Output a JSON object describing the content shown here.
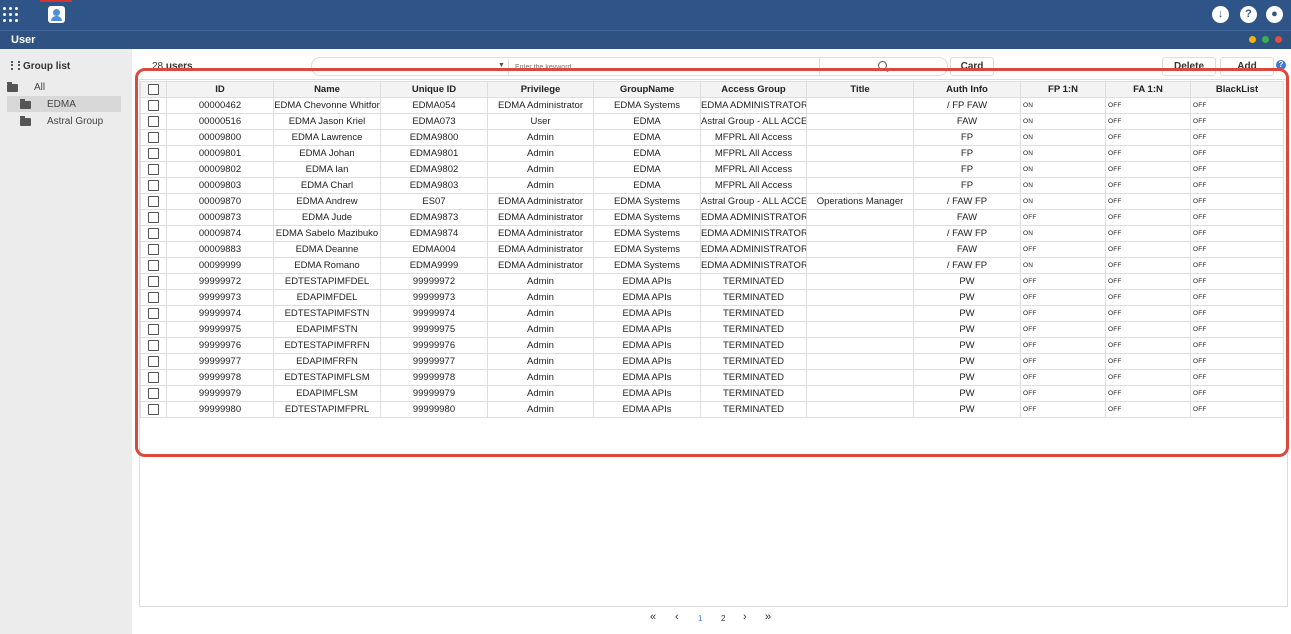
{
  "header": {
    "apps_icon": "grid-apps-icon",
    "user_app_icon": "user-app-icon",
    "right_icons": [
      "download-icon",
      "help-icon",
      "account-icon"
    ]
  },
  "window": {
    "title": "User",
    "buttons": {
      "minimize_color": "#f5b400",
      "maximize_color": "#34b34a",
      "close_color": "#e84c3d"
    }
  },
  "sidebar": {
    "heading": "Group list",
    "items": [
      {
        "label": "All"
      },
      {
        "label": "EDMA"
      },
      {
        "label": "Astral Group"
      }
    ]
  },
  "toolbar": {
    "count_value": "28",
    "count_unit": "users",
    "search_placeholder": "Enter the keyword",
    "card_label": "Card",
    "delete_label": "Delete",
    "add_label": "Add",
    "help_label": "?"
  },
  "table": {
    "headers": [
      "ID",
      "Name",
      "Unique ID",
      "Privilege",
      "GroupName",
      "Access Group",
      "Title",
      "Auth Info",
      "FP 1:N",
      "FA 1:N",
      "BlackList"
    ],
    "rows": [
      [
        "00000462",
        "EDMA Chevonne Whitfor",
        "EDMA054",
        "EDMA Administrator",
        "EDMA Systems",
        "EDMA ADMINISTRATOR",
        "",
        "/ FP FAW",
        "ON",
        "OFF",
        "OFF"
      ],
      [
        "00000516",
        "EDMA Jason Kriel",
        "EDMA073",
        "User",
        "EDMA",
        "Astral Group - ALL ACCES",
        "",
        "FAW",
        "ON",
        "OFF",
        "OFF"
      ],
      [
        "00009800",
        "EDMA Lawrence",
        "EDMA9800",
        "Admin",
        "EDMA",
        "MFPRL All Access",
        "",
        "FP",
        "ON",
        "OFF",
        "OFF"
      ],
      [
        "00009801",
        "EDMA Johan",
        "EDMA9801",
        "Admin",
        "EDMA",
        "MFPRL All Access",
        "",
        "FP",
        "ON",
        "OFF",
        "OFF"
      ],
      [
        "00009802",
        "EDMA Ian",
        "EDMA9802",
        "Admin",
        "EDMA",
        "MFPRL All Access",
        "",
        "FP",
        "ON",
        "OFF",
        "OFF"
      ],
      [
        "00009803",
        "EDMA Charl",
        "EDMA9803",
        "Admin",
        "EDMA",
        "MFPRL All Access",
        "",
        "FP",
        "ON",
        "OFF",
        "OFF"
      ],
      [
        "00009870",
        "EDMA Andrew",
        "ES07",
        "EDMA Administrator",
        "EDMA Systems",
        "Astral Group - ALL ACCES",
        "Operations Manager",
        "/ FAW FP",
        "ON",
        "OFF",
        "OFF"
      ],
      [
        "00009873",
        "EDMA Jude",
        "EDMA9873",
        "EDMA Administrator",
        "EDMA Systems",
        "EDMA ADMINISTRATOR",
        "",
        "FAW",
        "OFF",
        "OFF",
        "OFF"
      ],
      [
        "00009874",
        "EDMA Sabelo Mazibuko",
        "EDMA9874",
        "EDMA Administrator",
        "EDMA Systems",
        "EDMA ADMINISTRATOR",
        "",
        "/ FAW FP",
        "ON",
        "OFF",
        "OFF"
      ],
      [
        "00009883",
        "EDMA Deanne",
        "EDMA004",
        "EDMA Administrator",
        "EDMA Systems",
        "EDMA ADMINISTRATOR",
        "",
        "FAW",
        "OFF",
        "OFF",
        "OFF"
      ],
      [
        "00099999",
        "EDMA Romano",
        "EDMA9999",
        "EDMA Administrator",
        "EDMA Systems",
        "EDMA ADMINISTRATOR",
        "",
        "/ FAW FP",
        "ON",
        "OFF",
        "OFF"
      ],
      [
        "99999972",
        "EDTESTAPIMFDEL",
        "99999972",
        "Admin",
        "EDMA APIs",
        "TERMINATED",
        "",
        "PW",
        "OFF",
        "OFF",
        "OFF"
      ],
      [
        "99999973",
        "EDAPIMFDEL",
        "99999973",
        "Admin",
        "EDMA APIs",
        "TERMINATED",
        "",
        "PW",
        "OFF",
        "OFF",
        "OFF"
      ],
      [
        "99999974",
        "EDTESTAPIMFSTN",
        "99999974",
        "Admin",
        "EDMA APIs",
        "TERMINATED",
        "",
        "PW",
        "OFF",
        "OFF",
        "OFF"
      ],
      [
        "99999975",
        "EDAPIMFSTN",
        "99999975",
        "Admin",
        "EDMA APIs",
        "TERMINATED",
        "",
        "PW",
        "OFF",
        "OFF",
        "OFF"
      ],
      [
        "99999976",
        "EDTESTAPIMFRFN",
        "99999976",
        "Admin",
        "EDMA APIs",
        "TERMINATED",
        "",
        "PW",
        "OFF",
        "OFF",
        "OFF"
      ],
      [
        "99999977",
        "EDAPIMFRFN",
        "99999977",
        "Admin",
        "EDMA APIs",
        "TERMINATED",
        "",
        "PW",
        "OFF",
        "OFF",
        "OFF"
      ],
      [
        "99999978",
        "EDTESTAPIMFLSM",
        "99999978",
        "Admin",
        "EDMA APIs",
        "TERMINATED",
        "",
        "PW",
        "OFF",
        "OFF",
        "OFF"
      ],
      [
        "99999979",
        "EDAPIMFLSM",
        "99999979",
        "Admin",
        "EDMA APIs",
        "TERMINATED",
        "",
        "PW",
        "OFF",
        "OFF",
        "OFF"
      ],
      [
        "99999980",
        "EDTESTAPIMFPRL",
        "99999980",
        "Admin",
        "EDMA APIs",
        "TERMINATED",
        "",
        "PW",
        "OFF",
        "OFF",
        "OFF"
      ]
    ]
  },
  "pagination": {
    "first": "«",
    "prev": "‹",
    "pages": [
      "1",
      "2"
    ],
    "current": "1",
    "next": "›",
    "last": "»"
  },
  "colors": {
    "topbar": "#2f5487",
    "highlight_border": "#d94a3e",
    "current_page": "#3a78d6"
  }
}
